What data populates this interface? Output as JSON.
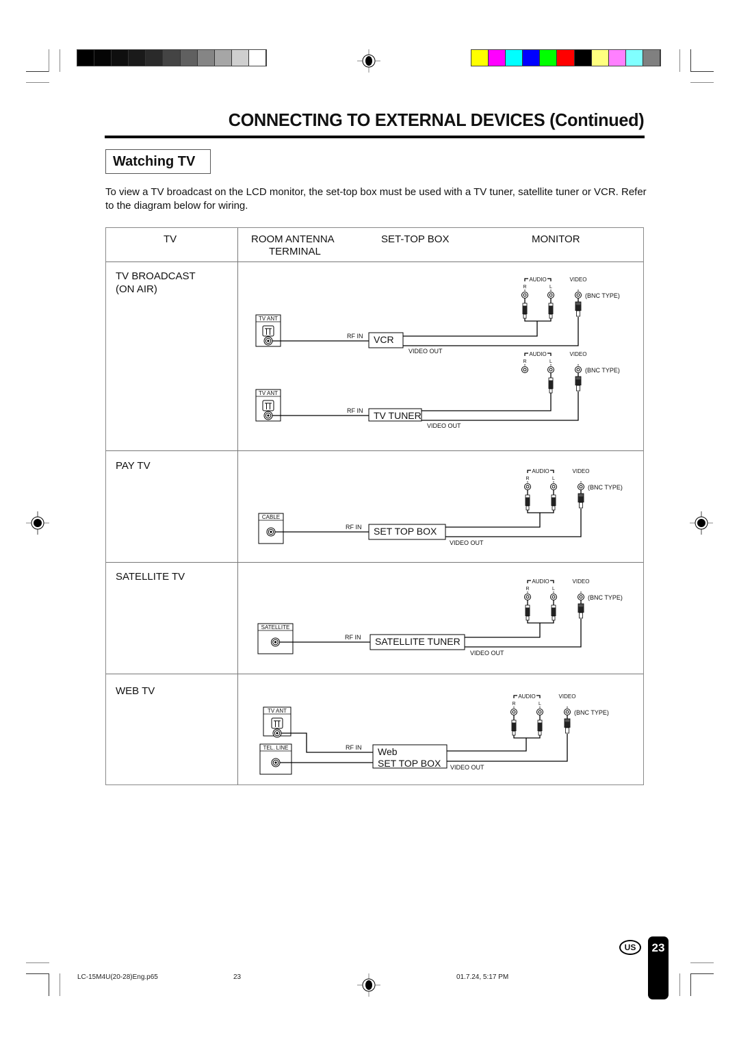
{
  "print_marks": {
    "grayscale_swatches": [
      "#000000",
      "#050505",
      "#0f0f0f",
      "#1a1a1a",
      "#2a2a2a",
      "#444444",
      "#606060",
      "#858585",
      "#a6a6a6",
      "#cfcfcf",
      "#ffffff"
    ],
    "color_swatches": [
      "#ffff00",
      "#ff00ff",
      "#00ffff",
      "#0000ff",
      "#00ff00",
      "#ff0000",
      "#000000",
      "#ffff80",
      "#ff80ff",
      "#80ffff",
      "#808080"
    ]
  },
  "header": {
    "title": "CONNECTING TO EXTERNAL DEVICES (Continued)"
  },
  "section": {
    "title": "Watching TV",
    "intro": "To view a TV broadcast on the LCD monitor, the set-top box must be used with a TV tuner, satellite tuner or VCR. Refer to the diagram below for wiring."
  },
  "table": {
    "columns": {
      "tv": "TV",
      "antenna_line1": "ROOM ANTENNA",
      "antenna_line2": "TERMINAL",
      "settop": "SET-TOP BOX",
      "monitor": "MONITOR"
    },
    "rows": [
      {
        "label_line1": "TV BROADCAST",
        "label_line2": "(ON AIR)"
      },
      {
        "label_line1": "PAY TV",
        "label_line2": ""
      },
      {
        "label_line1": "SATELLITE TV",
        "label_line2": ""
      },
      {
        "label_line1": "WEB TV",
        "label_line2": ""
      }
    ]
  },
  "diagram_labels": {
    "audio": "AUDIO",
    "video": "VIDEO",
    "r": "R",
    "l": "L",
    "bnc": "(BNC TYPE)",
    "rf_in": "RF IN",
    "video_out": "VIDEO OUT",
    "tv_ant": "TV ANT",
    "cable": "CABLE",
    "satellite": "SATELLITE",
    "tel_line": "TEL. LINE",
    "vcr": "VCR",
    "tv_tuner": "TV TUNER",
    "set_top_box": "SET TOP BOX",
    "satellite_tuner": "SATELLITE TUNER",
    "web_line1": "Web",
    "web_line2": "SET TOP BOX"
  },
  "footer": {
    "region_badge": "US",
    "page_number": "23",
    "file_name": "LC-15M4U(20-28)Eng.p65",
    "file_page": "23",
    "timestamp": "01.7.24, 5:17 PM"
  }
}
